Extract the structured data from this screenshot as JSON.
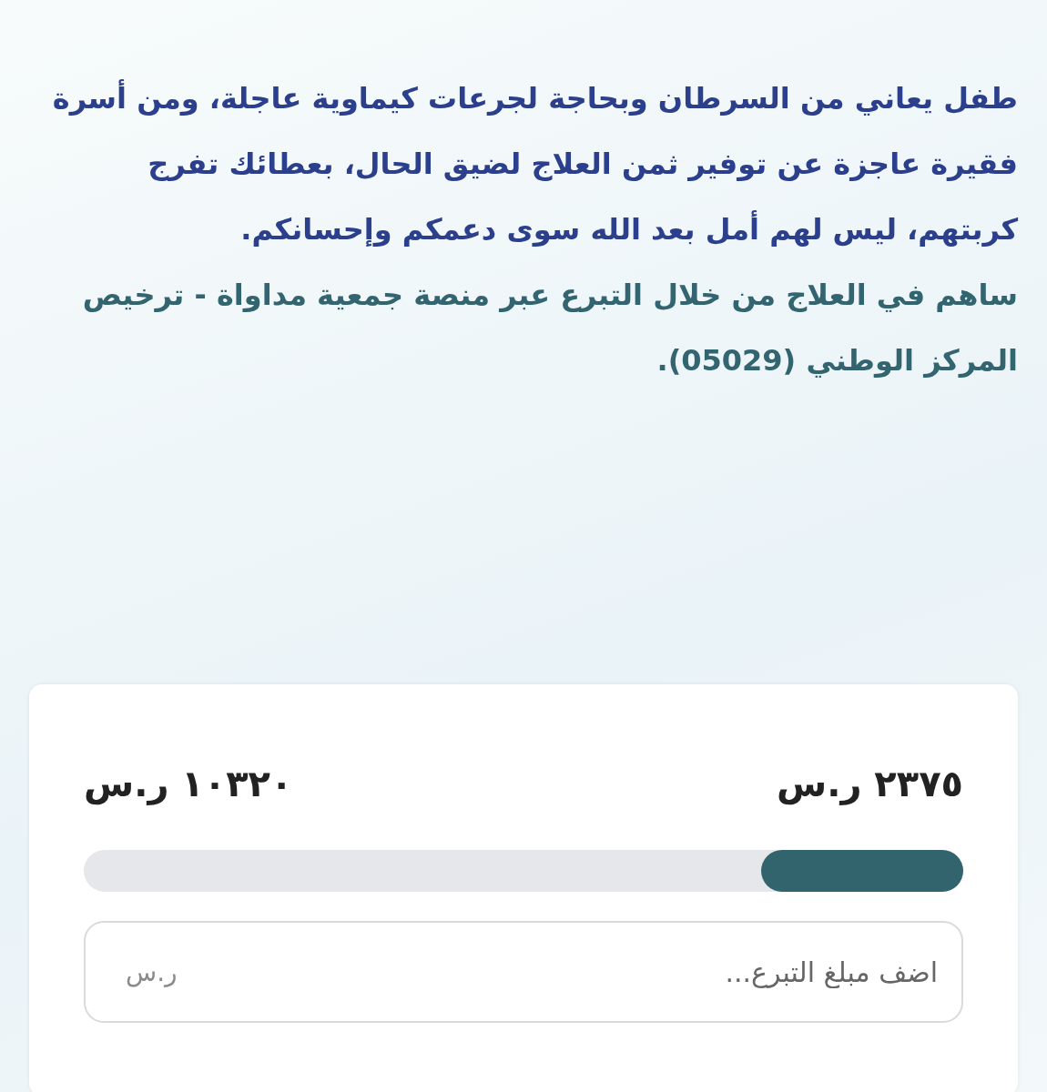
{
  "description": {
    "appeal": "طفل يعاني من السرطان وبحاجة لجرعات كيماوية عاجلة، ومن أسرة فقيرة عاجزة عن توفير ثمن العلاج لضيق الحال، بعطائك تفرج كربتهم، ليس لهم أمل بعد الله سوى دعمكم وإحسانكم.",
    "call_to_action": "ساهم في العلاج من خلال التبرع عبر منصة جمعية مداواة - ترخيص المركز الوطني (05029)."
  },
  "donation": {
    "raised": "٢٣٧٥ ر.س",
    "goal": "١٠٣٢٠ ر.س",
    "progress": {
      "level": 0.23
    },
    "amount_field": {
      "placeholder": "اضف مبلغ التبرع...",
      "currency": "ر.س"
    }
  }
}
